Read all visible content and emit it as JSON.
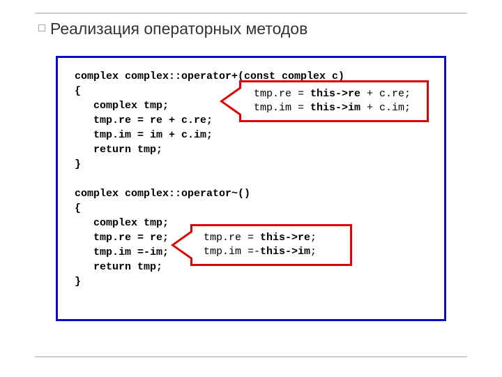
{
  "title": "Реализация операторных методов",
  "code": {
    "l1": "complex complex::operator+(const complex c)",
    "l2": "{",
    "l3": "   complex tmp;",
    "l4": "   tmp.re = re + c.re;",
    "l5": "   tmp.im = im + c.im;",
    "l6": "   return tmp;",
    "l7": "}",
    "l8": "",
    "l9": "complex complex::operator~()",
    "l10": "{",
    "l11": "   complex tmp;",
    "l12": "   tmp.re = re;",
    "l13": "   tmp.im =-im;",
    "l14": "   return tmp;",
    "l15": "}"
  },
  "callout1": {
    "line1_a": "tmp.re = ",
    "line1_b": "this->re",
    "line1_c": " + c.re;",
    "line2_a": "tmp.im = ",
    "line2_b": "this->im",
    "line2_c": " + c.im;"
  },
  "callout2": {
    "line1_a": "tmp.re = ",
    "line1_b": "this->re",
    "line1_c": ";",
    "line2_a": "tmp.im =-",
    "line2_b": "this->im",
    "line2_c": ";"
  }
}
